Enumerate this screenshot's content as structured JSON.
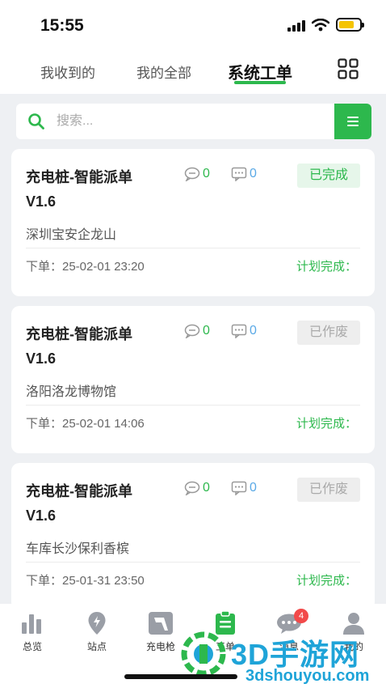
{
  "status_bar": {
    "time": "15:55",
    "battery_level": 0.75
  },
  "tabs": [
    {
      "label": "我收到的",
      "active": false
    },
    {
      "label": "我的全部",
      "active": false
    },
    {
      "label": "系统工单",
      "active": true
    }
  ],
  "search": {
    "placeholder": "搜索..."
  },
  "colors": {
    "accent": "#2db84d",
    "reply": "#5aa9e6",
    "badge": "#f24a4a",
    "watermark": "#1fa4d8"
  },
  "orders": [
    {
      "title": "充电桩-智能派单V1.6",
      "comment_count": "0",
      "reply_count": "0",
      "status": "已完成",
      "location": "深圳宝安企龙山",
      "order_time": "下单：25-02-01 23:20",
      "plan_label": "计划完成："
    },
    {
      "title": "充电桩-智能派单V1.6",
      "comment_count": "0",
      "reply_count": "0",
      "status": "已作废",
      "location": "洛阳洛龙博物馆",
      "order_time": "下单：25-02-01 14:06",
      "plan_label": "计划完成："
    },
    {
      "title": "充电桩-智能派单V1.6",
      "comment_count": "0",
      "reply_count": "0",
      "status": "已作废",
      "location": "车库长沙保利香槟",
      "order_time": "下单：25-01-31 23:50",
      "plan_label": "计划完成："
    }
  ],
  "bottom_nav": [
    {
      "label": "总览",
      "icon": "bar-chart-icon"
    },
    {
      "label": "站点",
      "icon": "location-pin-icon"
    },
    {
      "label": "充电枪",
      "icon": "charging-gun-icon"
    },
    {
      "label": "工单",
      "icon": "clipboard-icon",
      "active": true
    },
    {
      "label": "消息",
      "icon": "chat-bubble-icon",
      "badge": "4"
    },
    {
      "label": "我的",
      "icon": "user-icon"
    }
  ],
  "watermark": {
    "title": "3D手游网",
    "url": "3dshouyou.com"
  }
}
